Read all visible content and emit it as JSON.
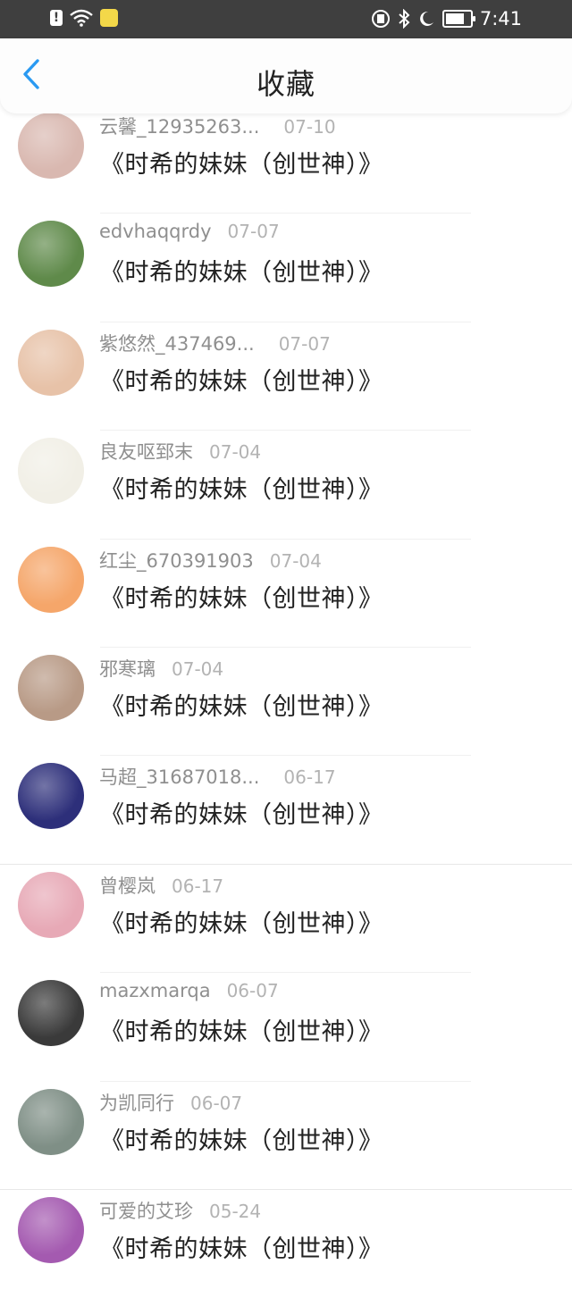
{
  "status_bar": {
    "time": "7:41",
    "alert_glyph": "!",
    "left_icons": [
      "alert-icon",
      "wifi-icon",
      "app-notification-icon"
    ],
    "right_icons": [
      "sim-icon",
      "bluetooth-icon",
      "moon-icon",
      "battery-icon"
    ]
  },
  "header": {
    "title": "收藏",
    "back_icon": "chevron-left-icon",
    "accent": "#2a9af2"
  },
  "favorites": [
    {
      "username": "云馨_12935263...",
      "date": "07-10",
      "title": "《时希的妹妹（创世神）》",
      "avatar_color": "#d9b8b0"
    },
    {
      "username": "edvhaqqrdy",
      "date": "07-07",
      "title": "《时希的妹妹（创世神）》",
      "avatar_color": "#5f8a4a"
    },
    {
      "username": "紫悠然_437469...",
      "date": "07-07",
      "title": "《时希的妹妹（创世神）》",
      "avatar_color": "#e7c2a8"
    },
    {
      "username": "良友呕郅末",
      "date": "07-04",
      "title": "《时希的妹妹（创世神）》",
      "avatar_color": "#f1efe6"
    },
    {
      "username": "红尘_670391903",
      "date": "07-04",
      "title": "《时希的妹妹（创世神）》",
      "avatar_color": "#f5a66a"
    },
    {
      "username": "邪寒璃",
      "date": "07-04",
      "title": "《时希的妹妹（创世神）》",
      "avatar_color": "#b89a86"
    },
    {
      "username": "马超_31687018...",
      "date": "06-17",
      "title": "《时希的妹妹（创世神）》",
      "avatar_color": "#2d2f7a"
    },
    {
      "username": "曾樱岚",
      "date": "06-17",
      "title": "《时希的妹妹（创世神）》",
      "avatar_color": "#e7a9b6"
    },
    {
      "username": "mazxmarqa",
      "date": "06-07",
      "title": "《时希的妹妹（创世神）》",
      "avatar_color": "#3a3a3a"
    },
    {
      "username": "为凯同行",
      "date": "06-07",
      "title": "《时希的妹妹（创世神）》",
      "avatar_color": "#7f8f86"
    },
    {
      "username": "可爱的艾珍",
      "date": "05-24",
      "title": "《时希的妹妹（创世神）》",
      "avatar_color": "#a45ab0"
    }
  ]
}
